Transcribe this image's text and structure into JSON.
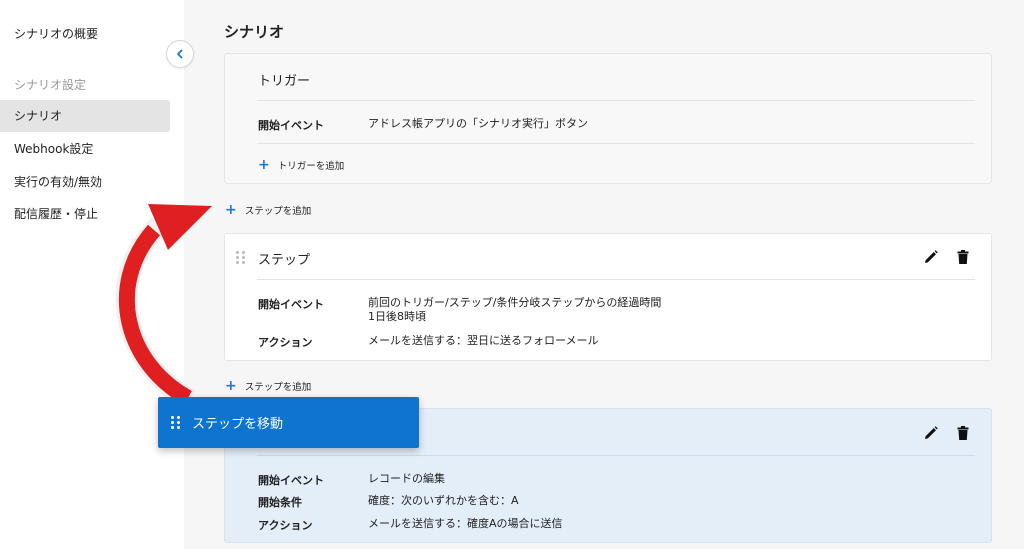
{
  "sidebar": {
    "overview": "シナリオの概要",
    "section_label": "シナリオ設定",
    "items": [
      {
        "label": "シナリオ",
        "active": true
      },
      {
        "label": "Webhook設定"
      },
      {
        "label": "実行の有効/無効"
      },
      {
        "label": "配信履歴・停止"
      }
    ],
    "collapse_icon": "chevron-left-icon"
  },
  "main": {
    "title": "シナリオ",
    "trigger_card": {
      "title": "トリガー",
      "start_event_label": "開始イベント",
      "start_event_value": "アドレス帳アプリの「シナリオ実行」ボタン",
      "add_trigger": "トリガーを追加"
    },
    "add_step_1": "ステップを追加",
    "step_card": {
      "title": "ステップ",
      "start_event_label": "開始イベント",
      "start_event_value_line1": "前回のトリガー/ステップ/条件分岐ステップからの経過時間",
      "start_event_value_line2": "1日後8時頃",
      "action_label": "アクション",
      "action_value": "メールを送信する：翌日に送るフォローメール"
    },
    "add_step_2": "ステップを追加",
    "step_card_2": {
      "start_event_label": "開始イベント",
      "start_event_value": "レコードの編集",
      "condition_label": "開始条件",
      "condition_value": "確度：次のいずれかを含む：A",
      "action_label": "アクション",
      "action_value": "メールを送信する：確度Aの場合に送信"
    },
    "move_tooltip": "ステップを移動"
  },
  "colors": {
    "accent": "#0f73d0",
    "arrow": "#e02020",
    "dragged_card_bg": "#e3eef8"
  }
}
